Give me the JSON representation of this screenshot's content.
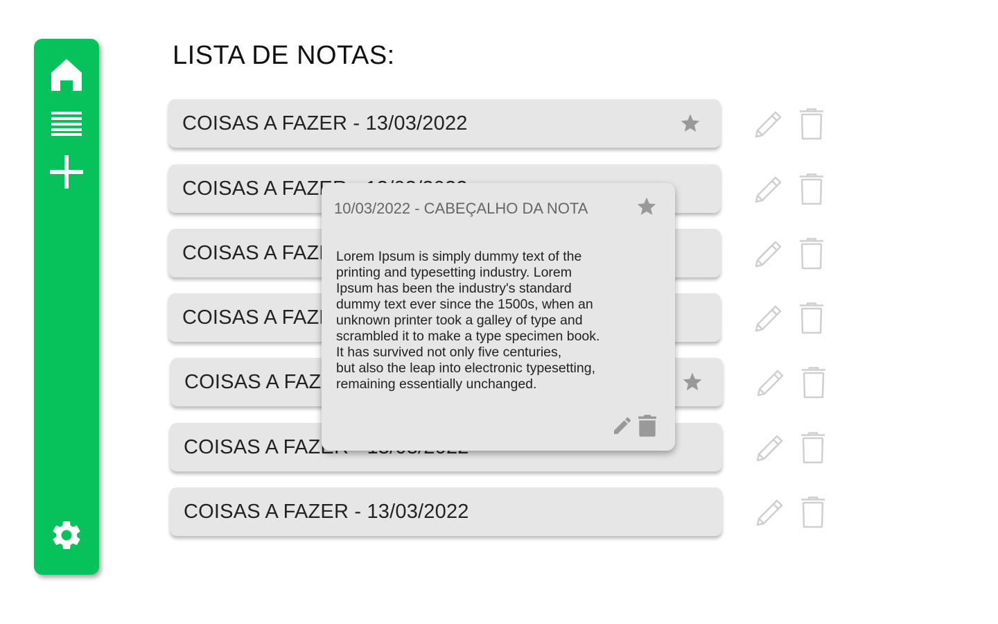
{
  "page": {
    "title": "LISTA DE NOTAS:"
  },
  "sidebar": {
    "items": [
      {
        "icon": "home-icon"
      },
      {
        "icon": "list-icon"
      },
      {
        "icon": "plus-icon"
      },
      {
        "icon": "gear-icon"
      }
    ],
    "color": "#05c35a"
  },
  "notes": [
    {
      "title": "COISAS A FAZER - 13/03/2022",
      "starred": true
    },
    {
      "title": "COISAS A FAZER - 13/03/2022",
      "starred": false
    },
    {
      "title": "COISAS A FAZER - 13/03/2022",
      "starred": false
    },
    {
      "title": "COISAS A FAZER - 13/03/2022",
      "starred": false
    },
    {
      "title": "COISAS A FAZER - 13/03/2022",
      "starred": true
    },
    {
      "title": "COISAS A FAZER - 13/03/2022",
      "starred": false
    },
    {
      "title": "COISAS A FAZER - 13/03/2022",
      "starred": false
    }
  ],
  "popup": {
    "header": "10/03/2022 - CABEÇALHO DA NOTA",
    "body": "Lorem Ipsum is simply dummy text of the\nprinting and typesetting industry. Lorem\nIpsum has been the industry's standard\ndummy text ever since the 1500s, when an\nunknown printer took a galley of type and\nscrambled it to make a type specimen book.\n It has survived not only five centuries,\nbut also the leap into electronic typesetting,\nremaining essentially unchanged."
  },
  "colors": {
    "accent": "#05c35a",
    "card": "#e6e6e6",
    "icon_gray": "#999999",
    "icon_light": "#d0d0d0"
  }
}
